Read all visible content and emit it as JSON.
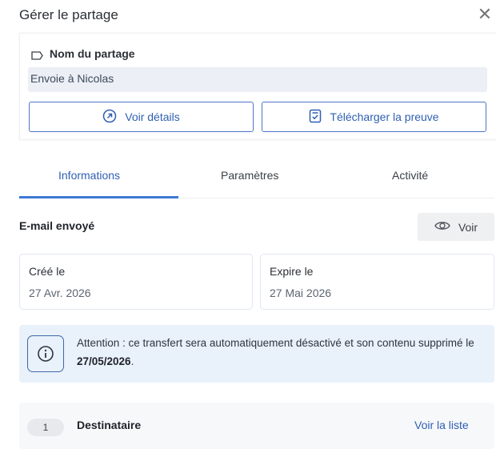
{
  "header": {
    "title": "Gérer le partage",
    "close_glyph": "✕"
  },
  "share": {
    "name_label": "Nom du partage",
    "name_value": "Envoie à Nicolas",
    "details_button": "Voir détails",
    "download_button": "Télécharger la preuve"
  },
  "tabs": [
    {
      "label": "Informations",
      "active": true
    },
    {
      "label": "Paramètres",
      "active": false
    },
    {
      "label": "Activité",
      "active": false
    }
  ],
  "email": {
    "label": "E-mail envoyé",
    "view_button": "Voir"
  },
  "dates": {
    "created_label": "Créé le",
    "created_value": "27 Avr. 2026",
    "expire_label": "Expire le",
    "expire_value": "27 Mai 2026"
  },
  "alert": {
    "text_before": "Attention : ce transfert sera automatiquement désactivé et son contenu supprimé le ",
    "date": "27/05/2026",
    "text_after": "."
  },
  "recipients": {
    "count": "1",
    "label": "Destinataire",
    "link": "Voir la liste"
  },
  "colors": {
    "accent": "#2f5fb3",
    "tab_underline": "#3e78d6",
    "alert_bg": "#e9f1fb"
  },
  "icons": {
    "tag": "tag-icon",
    "details": "arrow-up-right-circle-icon",
    "download": "receipt-check-icon",
    "view": "eye-icon",
    "alert": "info-icon",
    "close": "close-icon"
  }
}
